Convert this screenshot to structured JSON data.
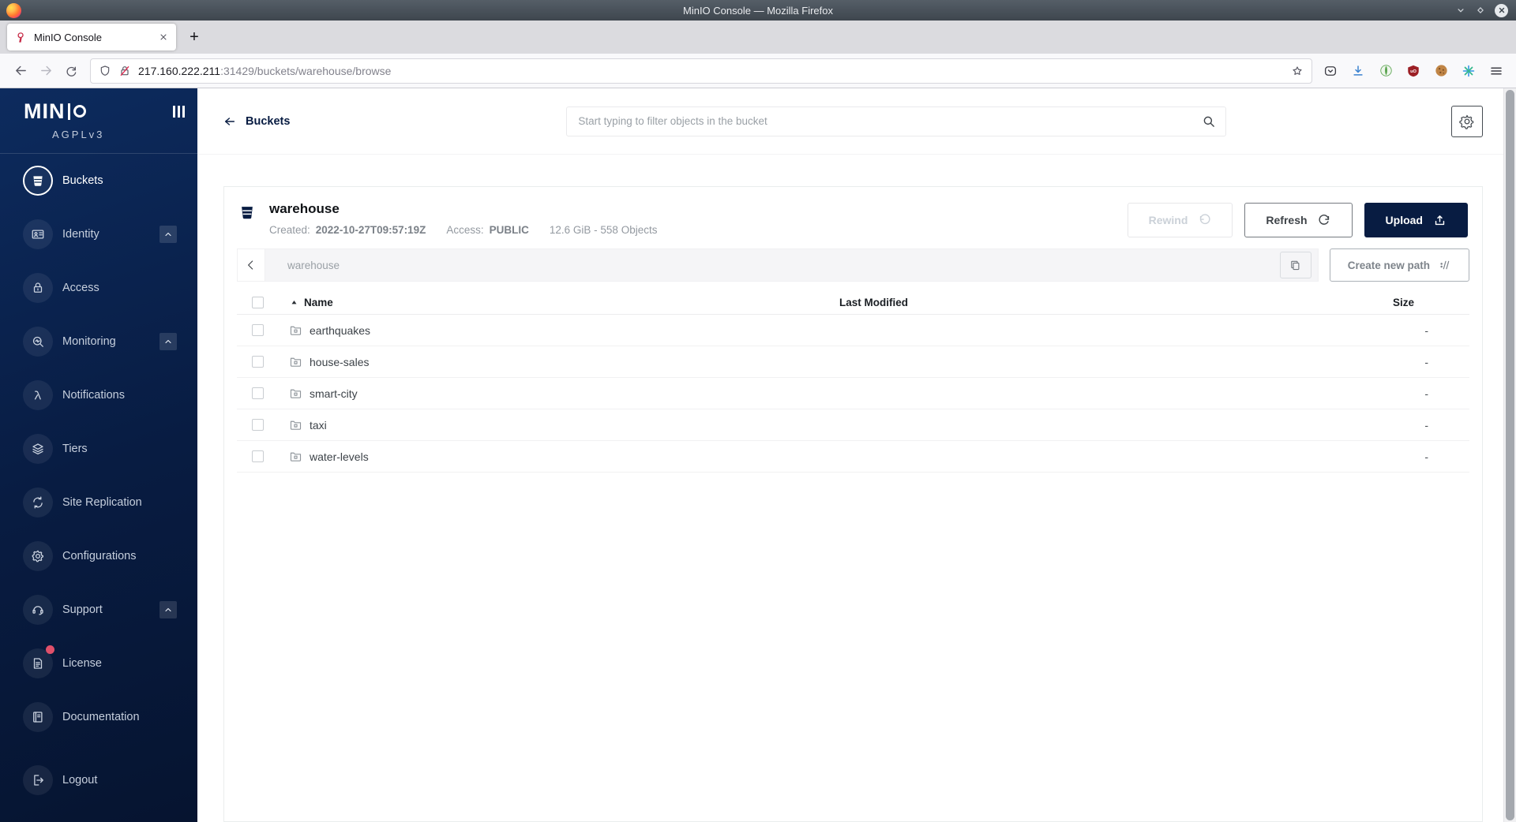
{
  "colors": {
    "accent": "#081C42",
    "badge": "#e0506a",
    "download": "#3b82d0"
  },
  "window": {
    "title": "MinIO Console — Mozilla Firefox"
  },
  "browser": {
    "tab_title": "MinIO Console",
    "new_tab_label": "+",
    "url_host": "217.160.222.211",
    "url_rest": ":31429/buckets/warehouse/browse",
    "toolbar_icons": [
      "pocket",
      "download",
      "privacy",
      "ublock",
      "cookie",
      "containers",
      "menu"
    ]
  },
  "sidebar": {
    "logo_text": "MINIO",
    "license": "AGPLv3",
    "items": [
      {
        "label": "Buckets",
        "icon": "bucket",
        "active": true
      },
      {
        "label": "Identity",
        "icon": "identity",
        "expandable": true
      },
      {
        "label": "Access",
        "icon": "access"
      },
      {
        "label": "Monitoring",
        "icon": "monitoring",
        "expandable": true
      },
      {
        "label": "Notifications",
        "icon": "notifications"
      },
      {
        "label": "Tiers",
        "icon": "tiers"
      },
      {
        "label": "Site Replication",
        "icon": "replication"
      },
      {
        "label": "Configurations",
        "icon": "configurations"
      },
      {
        "label": "Support",
        "icon": "support",
        "expandable": true
      },
      {
        "label": "License",
        "icon": "license",
        "badge": true
      },
      {
        "label": "Documentation",
        "icon": "documentation"
      },
      {
        "label": "Logout",
        "icon": "logout",
        "logout": true
      }
    ]
  },
  "header": {
    "back_label": "Buckets",
    "search_placeholder": "Start typing to filter objects in the bucket"
  },
  "bucket": {
    "name": "warehouse",
    "created_label": "Created:",
    "created_value": "2022-10-27T09:57:19Z",
    "access_label": "Access:",
    "access_value": "PUBLIC",
    "summary": "12.6 GiB - 558 Objects",
    "actions": {
      "rewind": "Rewind",
      "refresh": "Refresh",
      "upload": "Upload"
    }
  },
  "browse": {
    "path": "warehouse",
    "create_path_label": "Create new path"
  },
  "table": {
    "columns": {
      "name": "Name",
      "modified": "Last Modified",
      "size": "Size"
    },
    "sort": {
      "column": "Name",
      "direction": "asc"
    },
    "rows": [
      {
        "name": "earthquakes",
        "modified": "",
        "size": "-"
      },
      {
        "name": "house-sales",
        "modified": "",
        "size": "-"
      },
      {
        "name": "smart-city",
        "modified": "",
        "size": "-"
      },
      {
        "name": "taxi",
        "modified": "",
        "size": "-"
      },
      {
        "name": "water-levels",
        "modified": "",
        "size": "-"
      }
    ]
  }
}
